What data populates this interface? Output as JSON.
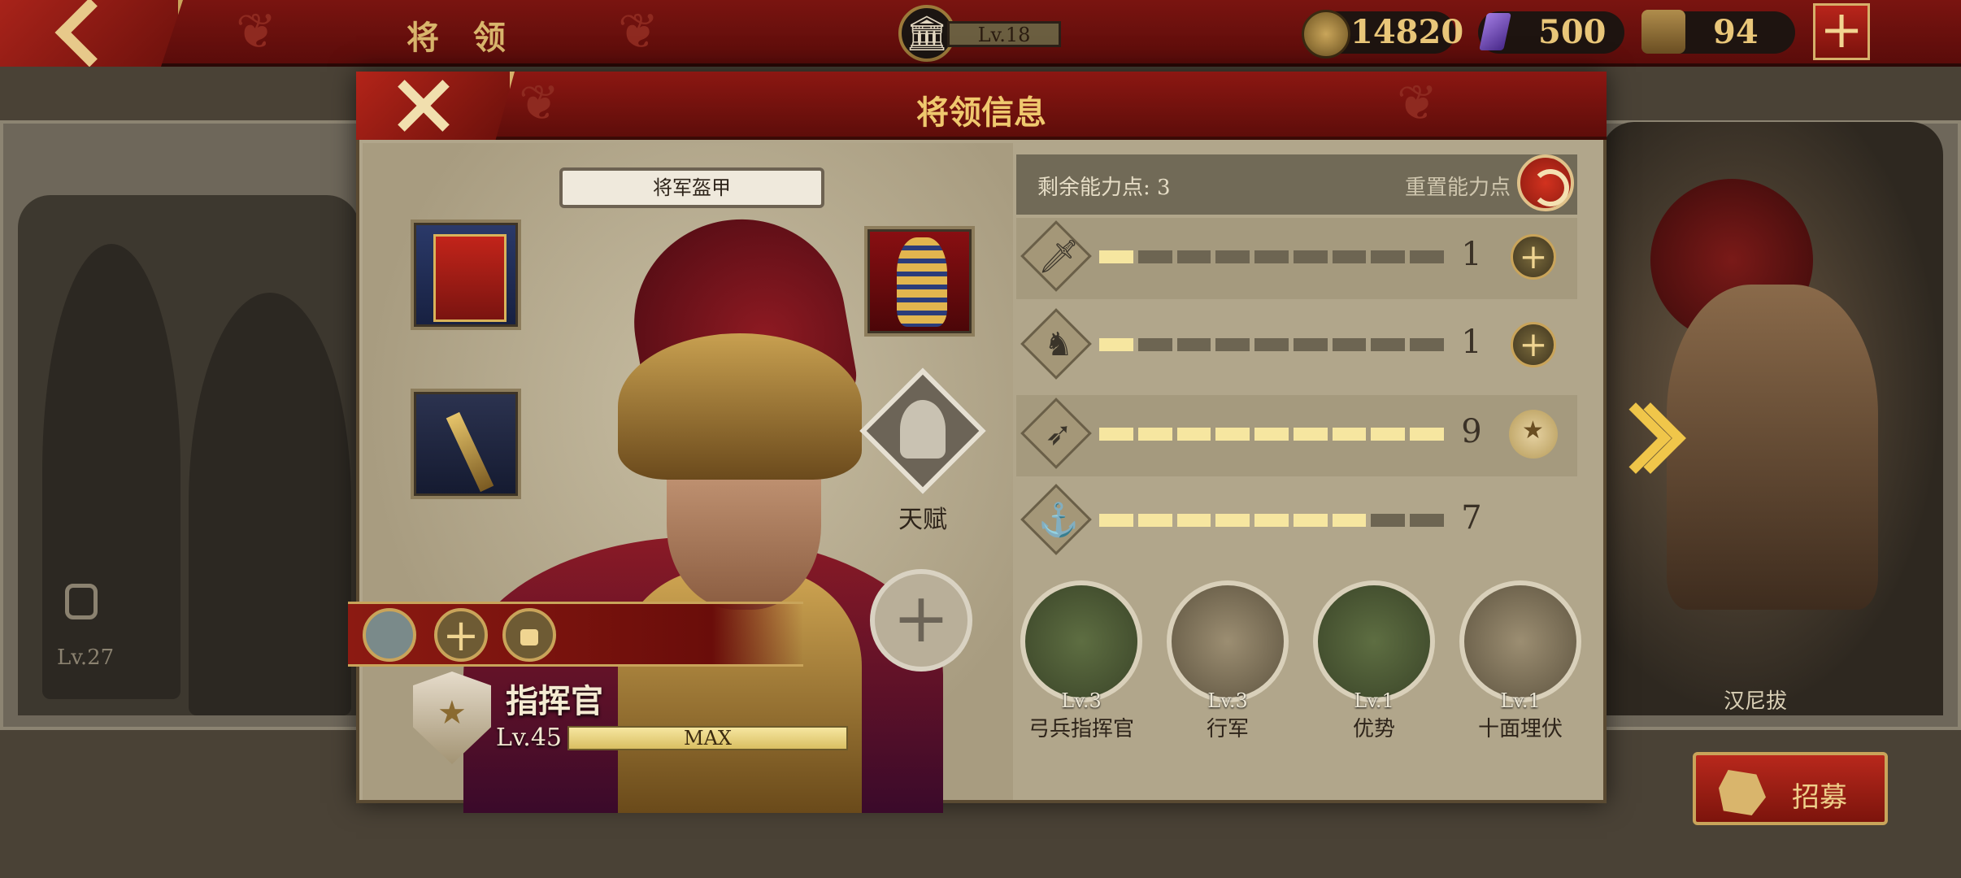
{
  "topbar": {
    "title": "将 领",
    "level_label": "Lv.18",
    "coins": "14820",
    "gems": "500",
    "spqr_tokens": "94",
    "add_label": "+"
  },
  "roster": {
    "left_level": "Lv.27",
    "right_name": "汉尼拔",
    "recruit_label": "招募"
  },
  "modal": {
    "title": "将领信息",
    "armor_label": "将军盔甲",
    "talent_label": "天赋",
    "commander": {
      "rank": "指挥官",
      "level": "Lv.45",
      "xp_label": "MAX",
      "xp_fraction": 1.0
    },
    "points": {
      "label": "剩余能力点: 3",
      "reset_label": "重置能力点"
    },
    "stats": [
      {
        "icon": "sword-icon",
        "value": "1",
        "segments": 9,
        "filled": 1,
        "action": "add"
      },
      {
        "icon": "horse-icon",
        "value": "1",
        "segments": 9,
        "filled": 1,
        "action": "add"
      },
      {
        "icon": "bow-icon",
        "value": "9",
        "segments": 9,
        "filled": 9,
        "action": "maxed"
      },
      {
        "icon": "anchor-icon",
        "value": "7",
        "segments": 9,
        "filled": 7,
        "action": "none"
      }
    ],
    "skills": [
      {
        "level": "Lv.3",
        "name": "弓兵指挥官"
      },
      {
        "level": "Lv.3",
        "name": "行军"
      },
      {
        "level": "Lv.1",
        "name": "优势"
      },
      {
        "level": "Lv.1",
        "name": "十面埋伏"
      }
    ]
  },
  "colors": {
    "header_red": "#7a1410",
    "gold": "#d9b56c",
    "panel": "#b1a68b",
    "bar_fill": "#f6e6a0"
  }
}
